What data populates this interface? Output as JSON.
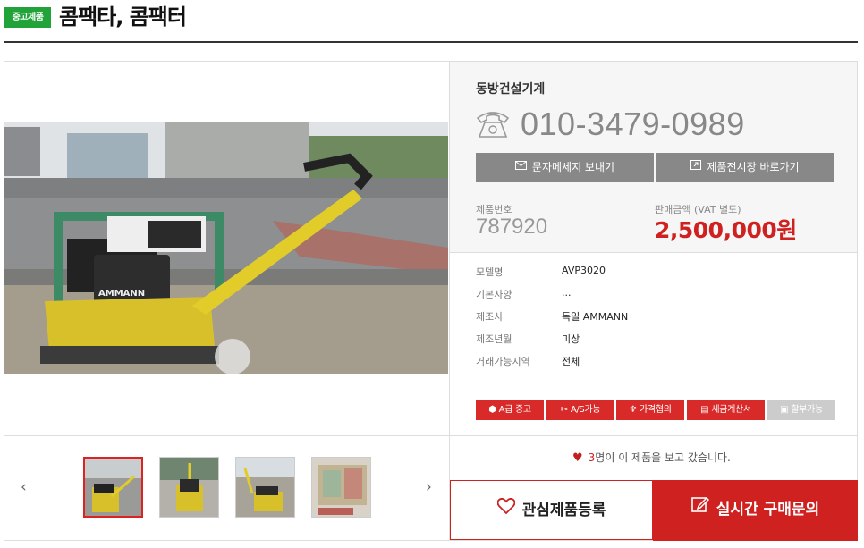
{
  "header": {
    "badge": "중고제품",
    "title": "콤팩타, 콤팩터"
  },
  "seller": {
    "company": "동방건설기계",
    "phone": "010-3479-0989"
  },
  "actions": {
    "sms_label": "문자메세지 보내기",
    "showroom_label": "제품전시장 바로가기"
  },
  "product": {
    "number_label": "제품번호",
    "number": "787920",
    "price_label": "판매금액 (VAT 별도)",
    "price": "2,500,000원"
  },
  "specs": [
    {
      "key": "모델명",
      "value": "AVP3020"
    },
    {
      "key": "기본사양",
      "value": "..."
    },
    {
      "key": "제조사",
      "value": "독일 AMMANN"
    },
    {
      "key": "제조년월",
      "value": "미상"
    },
    {
      "key": "거래가능지역",
      "value": "전체"
    }
  ],
  "tags": [
    {
      "label": "A급 중고",
      "icon": "cube-icon",
      "enabled": true
    },
    {
      "label": "A/S가능",
      "icon": "wrench-icon",
      "enabled": true
    },
    {
      "label": "가격협의",
      "icon": "handshake-icon",
      "enabled": true
    },
    {
      "label": "세금계산서",
      "icon": "receipt-icon",
      "enabled": true
    },
    {
      "label": "할부가능",
      "icon": "card-icon",
      "enabled": false
    }
  ],
  "viewers": {
    "count": "3",
    "text": "명이 이 제품을 보고 갔습니다."
  },
  "buttons": {
    "wish": "관심제품등록",
    "inquiry": "실시간 구매문의"
  },
  "thumbnails": {
    "prev": "‹",
    "next": "›",
    "count": 4,
    "selected_index": 0
  },
  "photo": {
    "brand_text": "AMMANN"
  },
  "colors": {
    "accent_red": "#d02121",
    "badge_green": "#22a33a",
    "button_gray": "#888888"
  }
}
